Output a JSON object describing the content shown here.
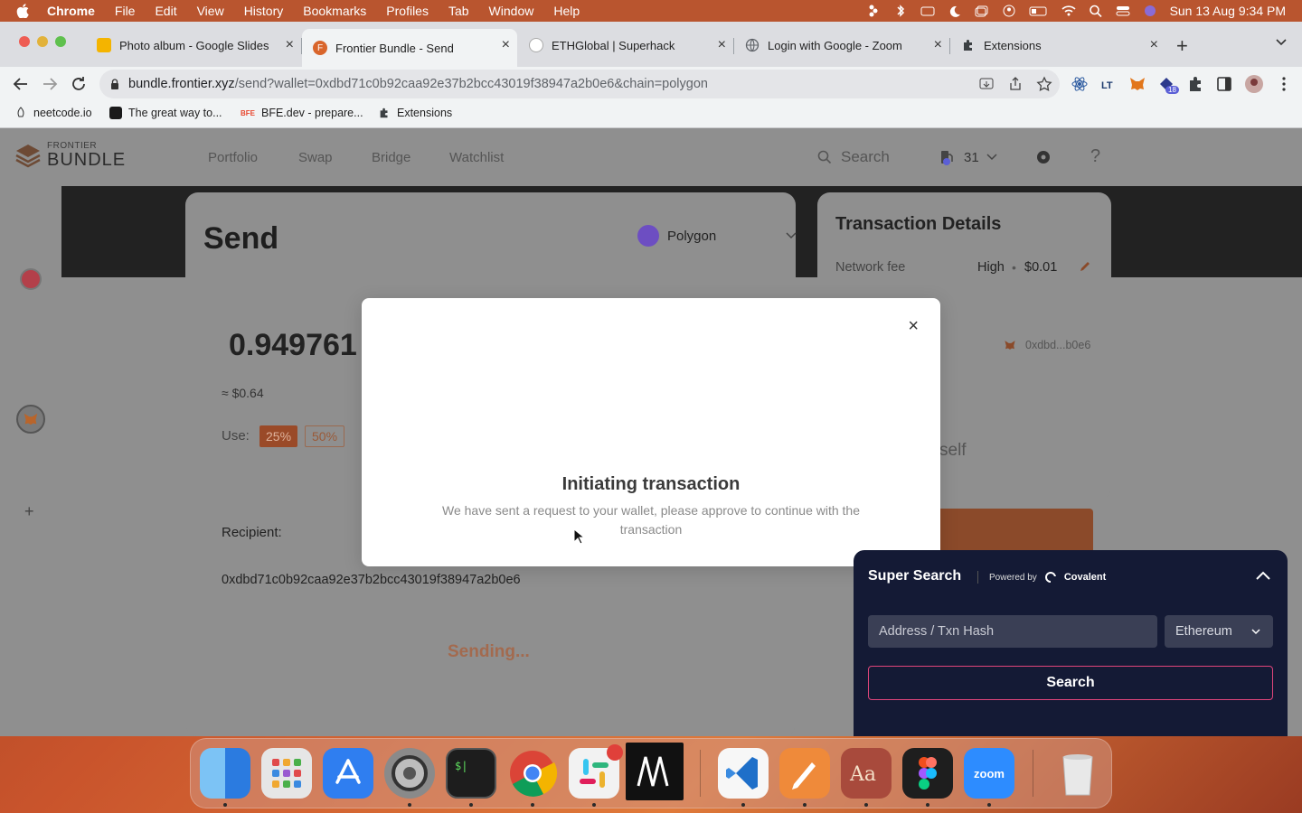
{
  "menubar": {
    "app": "Chrome",
    "items": [
      "File",
      "Edit",
      "View",
      "History",
      "Bookmarks",
      "Profiles",
      "Tab",
      "Window",
      "Help"
    ],
    "clock": "Sun 13 Aug  9:34 PM"
  },
  "tabs": [
    {
      "title": "Photo album - Google Slides",
      "icon": "slides-icon",
      "color": "#f4b400"
    },
    {
      "title": "Frontier Bundle - Send",
      "icon": "frontier-icon",
      "color": "#d9652b",
      "active": true
    },
    {
      "title": "ETHGlobal | Superhack",
      "icon": "ethglobal-icon",
      "color": "#888888"
    },
    {
      "title": "Login with Google - Zoom",
      "icon": "globe-icon",
      "color": "#5f6368"
    },
    {
      "title": "Extensions",
      "icon": "puzzle-icon",
      "color": "#5f6368"
    }
  ],
  "omnibox": {
    "host": "bundle.frontier.xyz",
    "path": "/send?wallet=0xdbd71c0b92caa92e37b2bcc43019f38947a2b0e6&chain=polygon"
  },
  "extensions": {
    "badge": "18"
  },
  "bookmarks": [
    {
      "label": "neetcode.io",
      "icon": "neetcode-icon"
    },
    {
      "label": "The great way to...",
      "icon": "codeinterview-icon"
    },
    {
      "label": "BFE.dev - prepare...",
      "icon": "bfe-icon",
      "tag": "BFE"
    },
    {
      "label": "Extensions",
      "icon": "puzzle-icon"
    }
  ],
  "app": {
    "logo_small": "FRONTIER",
    "logo_big": "BUNDLE",
    "nav": [
      "Portfolio",
      "Swap",
      "Bridge",
      "Watchlist"
    ],
    "search_label": "Search",
    "gas_value": "31",
    "gas_badge": "0",
    "help": "?"
  },
  "send": {
    "title": "Send",
    "chain": "Polygon",
    "amount": "0.949761",
    "fiat": "≈ $0.64",
    "use_label": "Use:",
    "pct": [
      "25%",
      "50%"
    ],
    "recipient_label": "Recipient:",
    "recipient": "0xdbd71c0b92caa92e37b2bcc43019f38947a2b0e6",
    "button": "Sending..."
  },
  "tx": {
    "title": "Transaction Details",
    "fee_label": "Network fee",
    "fee_speed": "High",
    "fee_amount": "$0.01",
    "wallet_short": "0xdbd...b0e6",
    "self_text": "self"
  },
  "modal": {
    "title": "Initiating transaction",
    "description": "We have sent a request to your wallet, please approve to continue with the transaction",
    "close": "×"
  },
  "super_search": {
    "title": "Super Search",
    "powered": "Powered by",
    "provider": "Covalent",
    "placeholder": "Address / Txn Hash",
    "network": "Ethereum",
    "button": "Search"
  },
  "dock": [
    {
      "name": "finder-icon",
      "color": "#3b8de0",
      "running": true
    },
    {
      "name": "launchpad-icon",
      "color": "#d9d9d9",
      "running": false
    },
    {
      "name": "app-store-icon",
      "color": "#2f7ef0",
      "running": false
    },
    {
      "name": "system-settings-icon",
      "color": "#7b7b7b",
      "running": true
    },
    {
      "name": "terminal-icon",
      "color": "#1d1d1d",
      "running": true
    },
    {
      "name": "chrome-icon",
      "color": "#ffffff",
      "running": true
    },
    {
      "name": "slack-icon",
      "color": "#f2f2f2",
      "running": true
    },
    {
      "name": "notion-icon",
      "color": "#111111",
      "running": false
    },
    {
      "name": "vscode-icon",
      "color": "#1e6fc9",
      "running": true
    },
    {
      "name": "sketch-pen-icon",
      "color": "#ef8a3a",
      "running": true
    },
    {
      "name": "dictionary-icon",
      "color": "#a84a3c",
      "running": true
    },
    {
      "name": "figma-icon",
      "color": "#1e1e1e",
      "running": true
    },
    {
      "name": "zoom-icon",
      "color": "#2d8cff",
      "running": true,
      "label": "zoom"
    },
    {
      "name": "trash-icon",
      "color": "#e7e7e7",
      "running": false
    }
  ],
  "colors": {
    "accent": "#c9542c",
    "supersearch_bg": "#141a35",
    "ss_border": "#e0457b"
  }
}
